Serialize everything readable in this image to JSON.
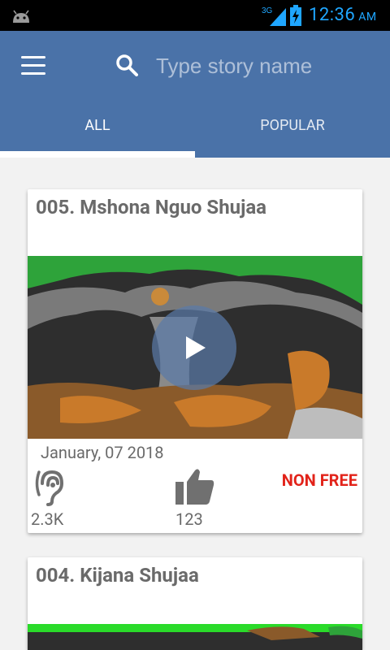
{
  "status_bar": {
    "time": "12:36",
    "ampm": "AM",
    "network": "3G"
  },
  "search": {
    "placeholder": "Type story name"
  },
  "tabs": [
    {
      "label": "ALL",
      "active": true
    },
    {
      "label": "POPULAR",
      "active": false
    }
  ],
  "stories": [
    {
      "title": "005. Mshona Nguo Shujaa",
      "date": "January, 07 2018",
      "listens": "2.3K",
      "likes": "123",
      "badge": "NON FREE"
    },
    {
      "title": "004. Kijana Shujaa"
    }
  ],
  "colors": {
    "app_bar": "#4a72a8",
    "badge": "#e2231a",
    "time": "#1fa6ff"
  }
}
